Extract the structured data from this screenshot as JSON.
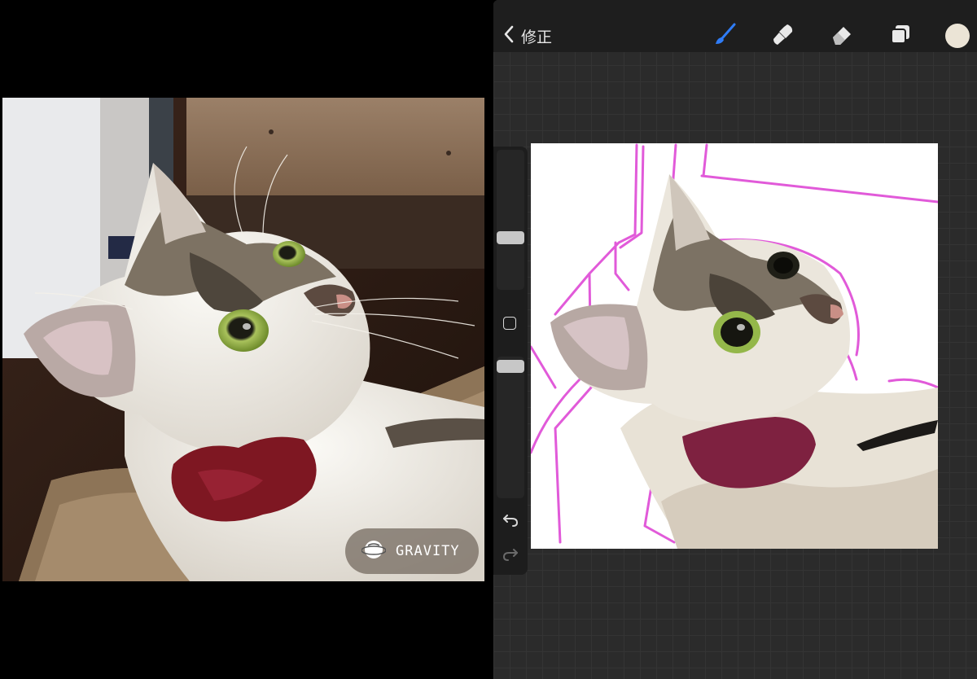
{
  "watermark": {
    "text": "GRAVITY",
    "icon": "planet-icon"
  },
  "toolbar": {
    "back_label": "修正",
    "back_icon": "chevron-left-icon",
    "tools": [
      {
        "name": "brush",
        "icon": "brush-icon",
        "active": true
      },
      {
        "name": "smudge",
        "icon": "smudge-icon",
        "active": false
      },
      {
        "name": "eraser",
        "icon": "eraser-icon",
        "active": false
      },
      {
        "name": "layers",
        "icon": "layers-icon",
        "active": false
      }
    ],
    "current_color": "#ebe4d6",
    "active_color": "#2f7cf6"
  },
  "sidebar": {
    "size_slider": "brush-size",
    "opacity_slider": "brush-opacity",
    "modify_icon": "square-icon",
    "undo_icon": "undo-icon",
    "redo_icon": "redo-icon"
  },
  "colors": {
    "sketch_lines": "#e15ad9",
    "bow": "#7e2140",
    "fur_light": "#e8e2d6"
  }
}
